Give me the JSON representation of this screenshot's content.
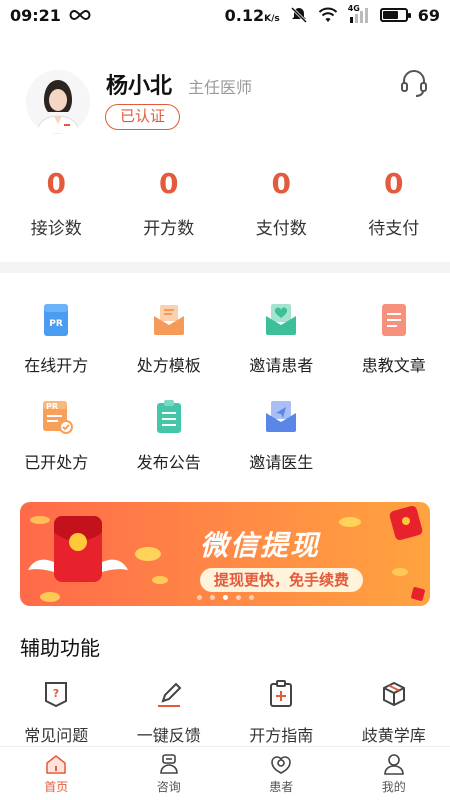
{
  "status_bar": {
    "time": "09:21",
    "speed": "0.12",
    "speed_unit": "K/s",
    "network_label": "4G",
    "battery": "69",
    "battery_level": 0.69
  },
  "profile": {
    "name": "杨小北",
    "title": "主任医师",
    "verified": "已认证"
  },
  "stats": [
    {
      "value": "0",
      "label": "接诊数"
    },
    {
      "value": "0",
      "label": "开方数"
    },
    {
      "value": "0",
      "label": "支付数"
    },
    {
      "value": "0",
      "label": "待支付"
    }
  ],
  "grid": [
    {
      "label": "在线开方",
      "icon": "pr-icon",
      "color": "#4a9df0"
    },
    {
      "label": "处方模板",
      "icon": "envelope-icon",
      "color": "#f59a59"
    },
    {
      "label": "邀请患者",
      "icon": "heart-mail-icon",
      "color": "#3dbf9a"
    },
    {
      "label": "患教文章",
      "icon": "article-icon",
      "color": "#f7907c"
    },
    {
      "label": "已开处方",
      "icon": "pr-check-icon",
      "color": "#f7a05a"
    },
    {
      "label": "发布公告",
      "icon": "notice-icon",
      "color": "#46c6a8"
    },
    {
      "label": "邀请医生",
      "icon": "send-mail-icon",
      "color": "#5a86e8"
    }
  ],
  "banner": {
    "title": "微信提现",
    "subtitle": "提现更快，免手续费",
    "slide_count": 5,
    "active_slide": 3
  },
  "aux_section": {
    "title": "辅助功能",
    "items": [
      {
        "label": "常见问题",
        "icon": "faq-icon"
      },
      {
        "label": "一键反馈",
        "icon": "edit-icon"
      },
      {
        "label": "开方指南",
        "icon": "guide-icon"
      },
      {
        "label": "歧黄学库",
        "icon": "box-icon"
      }
    ]
  },
  "tabbar": [
    {
      "label": "首页",
      "icon": "home-icon",
      "active": true
    },
    {
      "label": "咨询",
      "icon": "consult-icon",
      "active": false
    },
    {
      "label": "患者",
      "icon": "patient-icon",
      "active": false
    },
    {
      "label": "我的",
      "icon": "user-icon",
      "active": false
    }
  ],
  "colors": {
    "accent": "#e35a3c",
    "stat_number": "#e35a3c"
  }
}
